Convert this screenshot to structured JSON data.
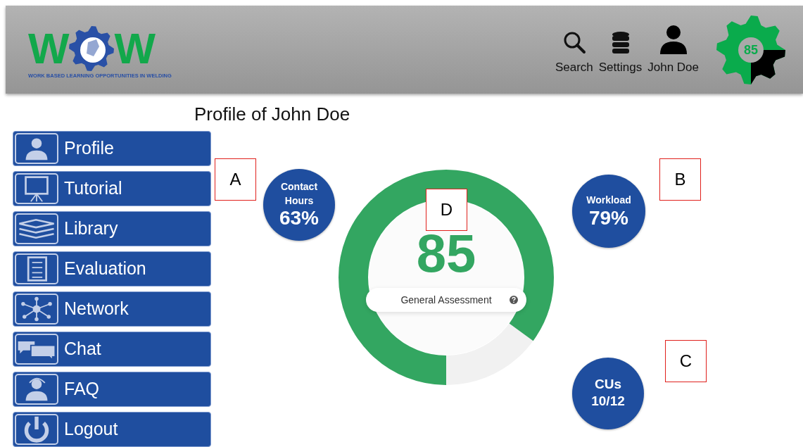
{
  "header": {
    "logo": {
      "left_letter": "W",
      "right_letter": "W",
      "tagline": "WORK BASED LEARNING OPPORTUNITIES IN WELDING"
    },
    "actions": [
      {
        "kind": "search",
        "label": "Search"
      },
      {
        "kind": "database",
        "label": "Settings"
      },
      {
        "kind": "person",
        "label": "John Doe"
      }
    ],
    "score_badge": {
      "value": "85"
    }
  },
  "page_title": "Profile of John Doe",
  "sidebar": {
    "items": [
      {
        "kind": "person",
        "label": "Profile"
      },
      {
        "kind": "board",
        "label": "Tutorial"
      },
      {
        "kind": "books",
        "label": "Library"
      },
      {
        "kind": "checklist",
        "label": "Evaluation"
      },
      {
        "kind": "network",
        "label": "Network"
      },
      {
        "kind": "chat",
        "label": "Chat"
      },
      {
        "kind": "headset",
        "label": "FAQ"
      },
      {
        "kind": "power",
        "label": "Logout"
      }
    ]
  },
  "metrics": [
    {
      "title": "Contact Hours",
      "value": "63%"
    },
    {
      "title": "Workload",
      "value": "79%"
    },
    {
      "title": "CUs",
      "value": "10/12"
    }
  ],
  "gauge": {
    "value": "85",
    "label": "General Assessment",
    "level": 0.85
  },
  "annotations": [
    {
      "label": "A"
    },
    {
      "label": "B"
    },
    {
      "label": "C"
    },
    {
      "label": "D"
    }
  ]
}
